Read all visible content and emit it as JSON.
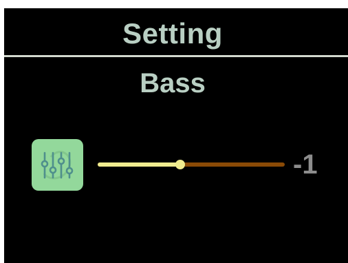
{
  "header": {
    "title": "Setting"
  },
  "setting": {
    "name": "Bass",
    "icon": "equalizer-icon",
    "value_label": "-1",
    "slider_fraction": 0.44
  },
  "colors": {
    "text": "#b9cfc3",
    "value_text": "#8d8d8d",
    "slider_filled": "#f0ec8f",
    "slider_remaining": "#8a4a06",
    "icon_tile": "#93d89b",
    "icon_stroke": "#4f8f8c"
  }
}
